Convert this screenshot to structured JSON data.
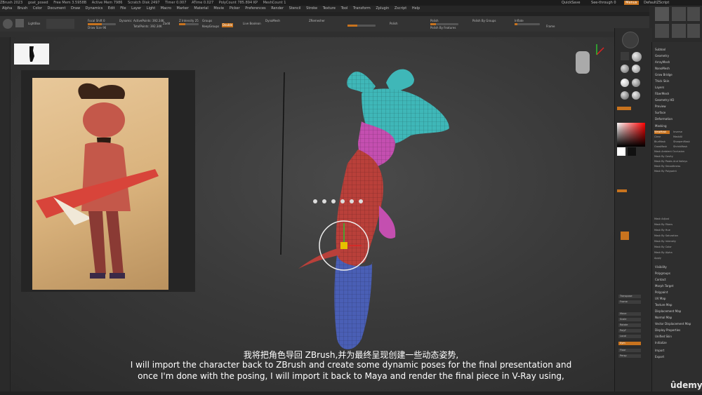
{
  "titlebar": {
    "app": "ZBrush 2023",
    "file": "goat_posed",
    "info": [
      "Free Mem 3.5958B",
      "Active Mem 7986",
      "Scratch Disk 2497",
      "Timer 0.007",
      "ATime 0.027",
      "PolyCount 785.894 KP",
      "MeshCount 1"
    ],
    "right": [
      "QuickSave",
      "See-through 0",
      "Menus",
      "DefaultZScript"
    ]
  },
  "menubar": [
    "Alpha",
    "Brush",
    "Color",
    "Document",
    "Draw",
    "Dynamics",
    "Edit",
    "File",
    "Layer",
    "Light",
    "Macro",
    "Marker",
    "Material",
    "Movie",
    "Picker",
    "Preferences",
    "Render",
    "Stencil",
    "Stroke",
    "Texture",
    "Tool",
    "Transform",
    "Zplugin",
    "Zscript",
    "Help"
  ],
  "toolbar": {
    "lightbox": "LightBox",
    "focal": "Focal Shift 0",
    "draw_size": "Draw Size 96",
    "active_points": "ActivePoints: 392.34K",
    "total_points": "TotalPoints: 392.34K",
    "dynamic": "Dynamic",
    "zadd": "Zadd",
    "zsub": "Zsub",
    "zintensity": "Z Intensity 25",
    "rgb_intensity": "Rgb Intensity 100",
    "mrgb": "Mrgb",
    "rgb": "Rgb",
    "m": "M",
    "groups": "Groups",
    "keepgroups": "KeepGroups",
    "double": "Double",
    "liveboolean": "Live Boolean",
    "dynamesh": "DynaMesh",
    "zremesher": "ZRemesher",
    "polish_label": "Polish",
    "polish_groups": "Polish By Groups",
    "polish_features": "Polish By Features",
    "inflate": "Inflate",
    "frame": "Frame"
  },
  "subtitles": {
    "cn": "我将把角色导回 ZBrush,并为最终呈现创建一些动态姿势,",
    "en1": "I will import the character back to ZBrush and create some dynamic poses for the final presentation and",
    "en2": "once I'm done with the posing, I will import it back to Maya and render the final piece in V-Ray using,"
  },
  "watermark": "ûdemy",
  "right_panel": {
    "menu": [
      "Subtool",
      "Geometry",
      "ArrayMesh",
      "NanoMesh",
      "Grow Bridge",
      "Thick Skin",
      "Layers",
      "FiberMesh",
      "Geometry HD",
      "Preview",
      "Surface",
      "Deformation",
      "Masking",
      "Visibility",
      "Polygroups",
      "Contact",
      "Morph Target",
      "Polypaint",
      "UV Map",
      "Texture Map",
      "Displacement Map",
      "Normal Map",
      "Vector Displacement Map",
      "Display Properties",
      "Unified Skin",
      "Initialize",
      "Import",
      "Export"
    ],
    "masking_sub": [
      "ViewMask",
      "Inverse",
      "Clear",
      "MaskAll",
      "BlurMask",
      "SharpenMask",
      "GrowMask",
      "ShrinkMask",
      "Mask Ambient Occlusion",
      "Mask By Cavity",
      "Mask By Peaks And Valleys",
      "Mask By Smoothness",
      "Mask By Polypaint",
      "Mask Adjust",
      "Mask By Fibers",
      "Mask By Hue",
      "Mask By Saturation",
      "Mask By Intensity",
      "Mask By Color",
      "Mask By Alpha",
      "Apply"
    ]
  },
  "mid_panel": [
    "Transpose",
    "Frame",
    "Move",
    "Scale",
    "Rotate",
    "PolyF",
    "Local",
    "Sym",
    "Floor",
    "Persp",
    "Solo",
    "Xpose",
    "Transp",
    "Dynamic",
    "Ghost",
    "Line Fill",
    "Spix"
  ],
  "colors": {
    "accent": "#c8731e",
    "viewport_bg": "#3a3a3a",
    "panel_bg": "#2e2e2e",
    "mesh_teal": "#3fb7b8",
    "mesh_pink": "#c44fb0",
    "mesh_red": "#b9403a",
    "mesh_blue": "#4a5fb5"
  }
}
